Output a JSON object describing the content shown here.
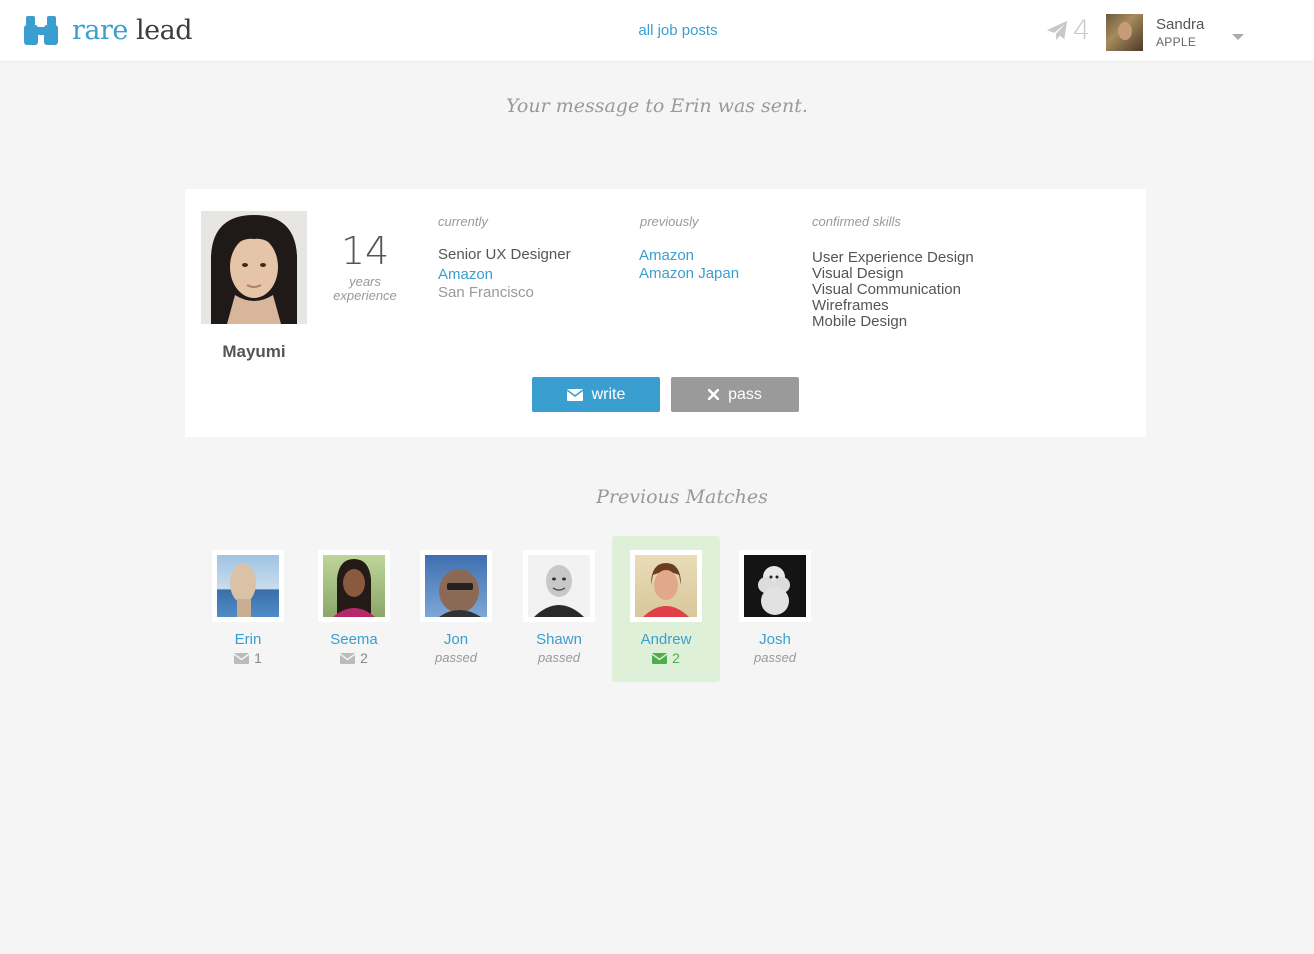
{
  "header": {
    "logo_rare": "rare",
    "logo_lead": "lead",
    "nav_link": "all job posts",
    "message_count": "4",
    "user_name": "Sandra",
    "user_company": "APPLE"
  },
  "notice": "Your message to Erin was sent.",
  "candidate": {
    "name": "Mayumi",
    "years": "14",
    "years_label_1": "years",
    "years_label_2": "experience",
    "currently_heading": "currently",
    "current_title": "Senior UX Designer",
    "current_company": "Amazon",
    "current_location": "San Francisco",
    "previously_heading": "previously",
    "previous_companies": [
      "Amazon",
      "Amazon Japan"
    ],
    "skills_heading": "confirmed skills",
    "skills": [
      "User Experience Design",
      "Visual Design",
      "Visual Communication",
      "Wireframes",
      "Mobile Design"
    ],
    "write_label": "write",
    "pass_label": "pass"
  },
  "previous_matches_title": "Previous Matches",
  "matches": [
    {
      "name": "Erin",
      "status": "",
      "count": "1"
    },
    {
      "name": "Seema",
      "status": "",
      "count": "2"
    },
    {
      "name": "Jon",
      "status": "passed",
      "count": ""
    },
    {
      "name": "Shawn",
      "status": "passed",
      "count": ""
    },
    {
      "name": "Andrew",
      "status": "",
      "count": "2"
    },
    {
      "name": "Josh",
      "status": "passed",
      "count": ""
    }
  ],
  "colors": {
    "accent": "#3a9fd0",
    "active_match_bg": "#dff0d8",
    "active_count": "#4cae4c",
    "pass_button": "#9a9a9a"
  }
}
